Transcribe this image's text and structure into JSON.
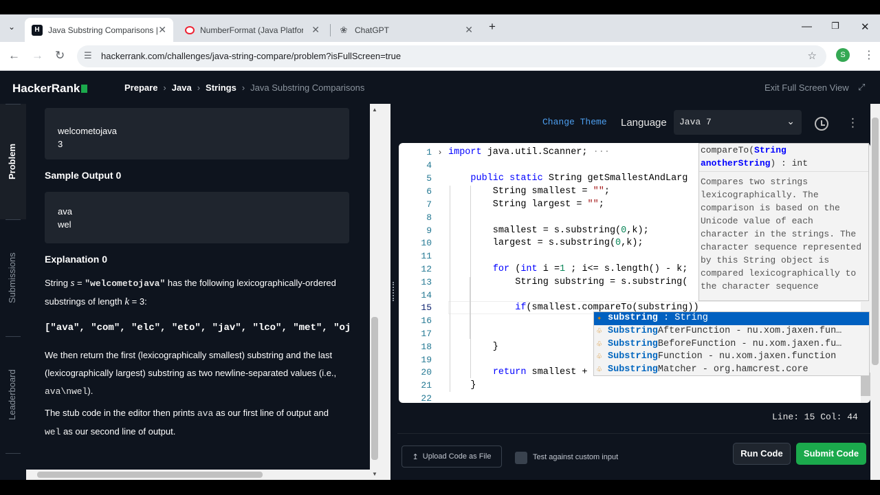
{
  "browser": {
    "tabs": [
      {
        "title": "Java Substring Comparisons | H",
        "favicon": "hackerrank-icon",
        "active": true
      },
      {
        "title": "NumberFormat (Java Platform S",
        "favicon": "oracle-icon",
        "active": false
      },
      {
        "title": "ChatGPT",
        "favicon": "chatgpt-icon",
        "active": false
      }
    ],
    "url": "hackerrank.com/challenges/java-string-compare/problem?isFullScreen=true",
    "profile_initial": "S"
  },
  "header": {
    "logo": "HackerRank",
    "breadcrumbs": [
      "Prepare",
      "Java",
      "Strings",
      "Java Substring Comparisons"
    ],
    "exit_full_screen": "Exit Full Screen View"
  },
  "rail": {
    "items": [
      "Problem",
      "Submissions",
      "Leaderboard"
    ]
  },
  "problem": {
    "sample_input_lines": [
      "welcometojava",
      "3"
    ],
    "sample_output_heading": "Sample Output 0",
    "sample_output_lines": [
      "ava",
      "wel"
    ],
    "explanation_heading": "Explanation 0",
    "expl_p1_a": "String ",
    "expl_p1_s": "s",
    "expl_p1_eq": " = ",
    "expl_p1_str": "\"welcometojava\"",
    "expl_p1_b": " has the following lexicographically-ordered",
    "expl_p1_c": "substrings of length ",
    "expl_p1_k": "k",
    "expl_p1_d": " = 3:",
    "array_line": "[\"ava\", \"com\", \"elc\", \"eto\", \"jav\", \"lco\", \"met\", \"oj",
    "expl_p2_a": "We then return the first (lexicographically smallest) substring and the last",
    "expl_p2_b": "(lexicographically largest) substring as two newline-separated values (i.e.,",
    "expl_p2_code": "ava\\nwel",
    "expl_p2_c": ").",
    "expl_p3_a": "The stub code in the editor then prints ",
    "expl_p3_code1": "ava",
    "expl_p3_b": " as our first line of output and",
    "expl_p3_code2": "wel",
    "expl_p3_c": " as our second line of output."
  },
  "editor": {
    "change_theme": "Change Theme",
    "language_label": "Language",
    "language_value": "Java 7",
    "line_numbers": [
      "1",
      "4",
      "5",
      "6",
      "7",
      "8",
      "9",
      "10",
      "11",
      "12",
      "13",
      "14",
      "15",
      "16",
      "17",
      "18",
      "19",
      "20",
      "21",
      "22"
    ],
    "status": "Line: 15 Col: 44"
  },
  "doc_popup": {
    "signature_a": "compareTo(",
    "signature_b": "String",
    "signature_c": "anotherString",
    "signature_d": ") : int",
    "body": "Compares two strings lexicographically. The comparison is based on the Unicode value of each character in the strings. The character sequence represented by this String object is compared lexicographically to the character sequence"
  },
  "suggestions": [
    {
      "match": "substring",
      "rest": " : String",
      "selected": true
    },
    {
      "match": "Substring",
      "rest": "AfterFunction - nu.xom.jaxen.fun…",
      "selected": false
    },
    {
      "match": "Substring",
      "rest": "BeforeFunction - nu.xom.jaxen.fu…",
      "selected": false
    },
    {
      "match": "Substring",
      "rest": "Function - nu.xom.jaxen.function",
      "selected": false
    },
    {
      "match": "Substring",
      "rest": "Matcher - org.hamcrest.core",
      "selected": false
    }
  ],
  "bottom": {
    "upload": "Upload Code as File",
    "custom_input": "Test against custom input",
    "run": "Run Code",
    "submit": "Submit Code"
  },
  "colors": {
    "brand_green": "#1ba94c",
    "background": "#0e141e",
    "selection_blue": "#0060c0"
  }
}
